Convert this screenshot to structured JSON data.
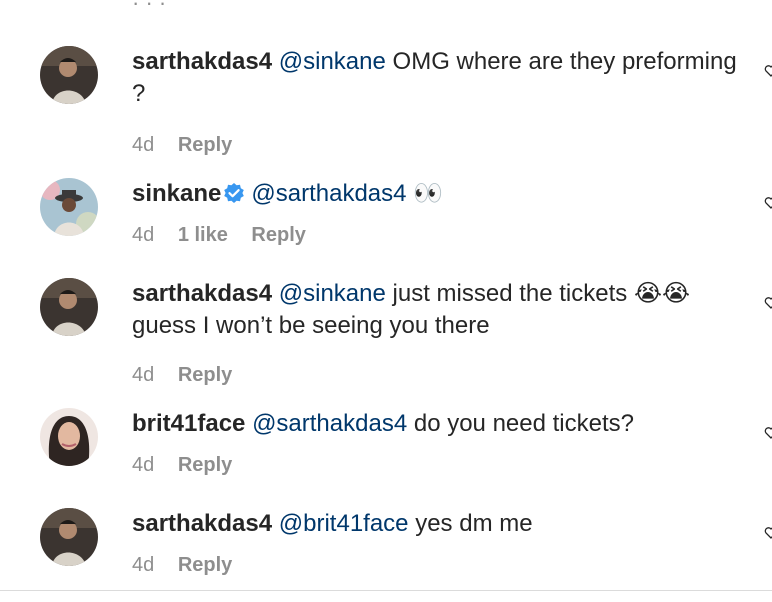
{
  "comments": [
    {
      "username": "sarthakdas4",
      "mention": "@sinkane",
      "text": " OMG where are they preforming ?",
      "age": "4d",
      "likes": "",
      "reply_label": "Reply",
      "verified": false
    },
    {
      "username": "sinkane",
      "mention": "@sarthakdas4",
      "text": " 👀",
      "age": "4d",
      "likes": "1 like",
      "reply_label": "Reply",
      "verified": true
    },
    {
      "username": "sarthakdas4",
      "mention": "@sinkane",
      "text": " just missed the tickets 😭😭 guess I won’t be seeing you there",
      "age": "4d",
      "likes": "",
      "reply_label": "Reply",
      "verified": false
    },
    {
      "username": "brit41face",
      "mention": "@sarthakdas4",
      "text": " do you need tickets?",
      "age": "4d",
      "likes": "",
      "reply_label": "Reply",
      "verified": false
    },
    {
      "username": "sarthakdas4",
      "mention": "@brit41face",
      "text": " yes dm me",
      "age": "4d",
      "likes": "",
      "reply_label": "Reply",
      "verified": false
    }
  ],
  "colors": {
    "text": "#262626",
    "mention": "#00376b",
    "meta": "#8e8e8e",
    "verified": "#3897f0"
  },
  "icons": {
    "verified": "verified-badge-icon",
    "like": "heart-icon"
  }
}
